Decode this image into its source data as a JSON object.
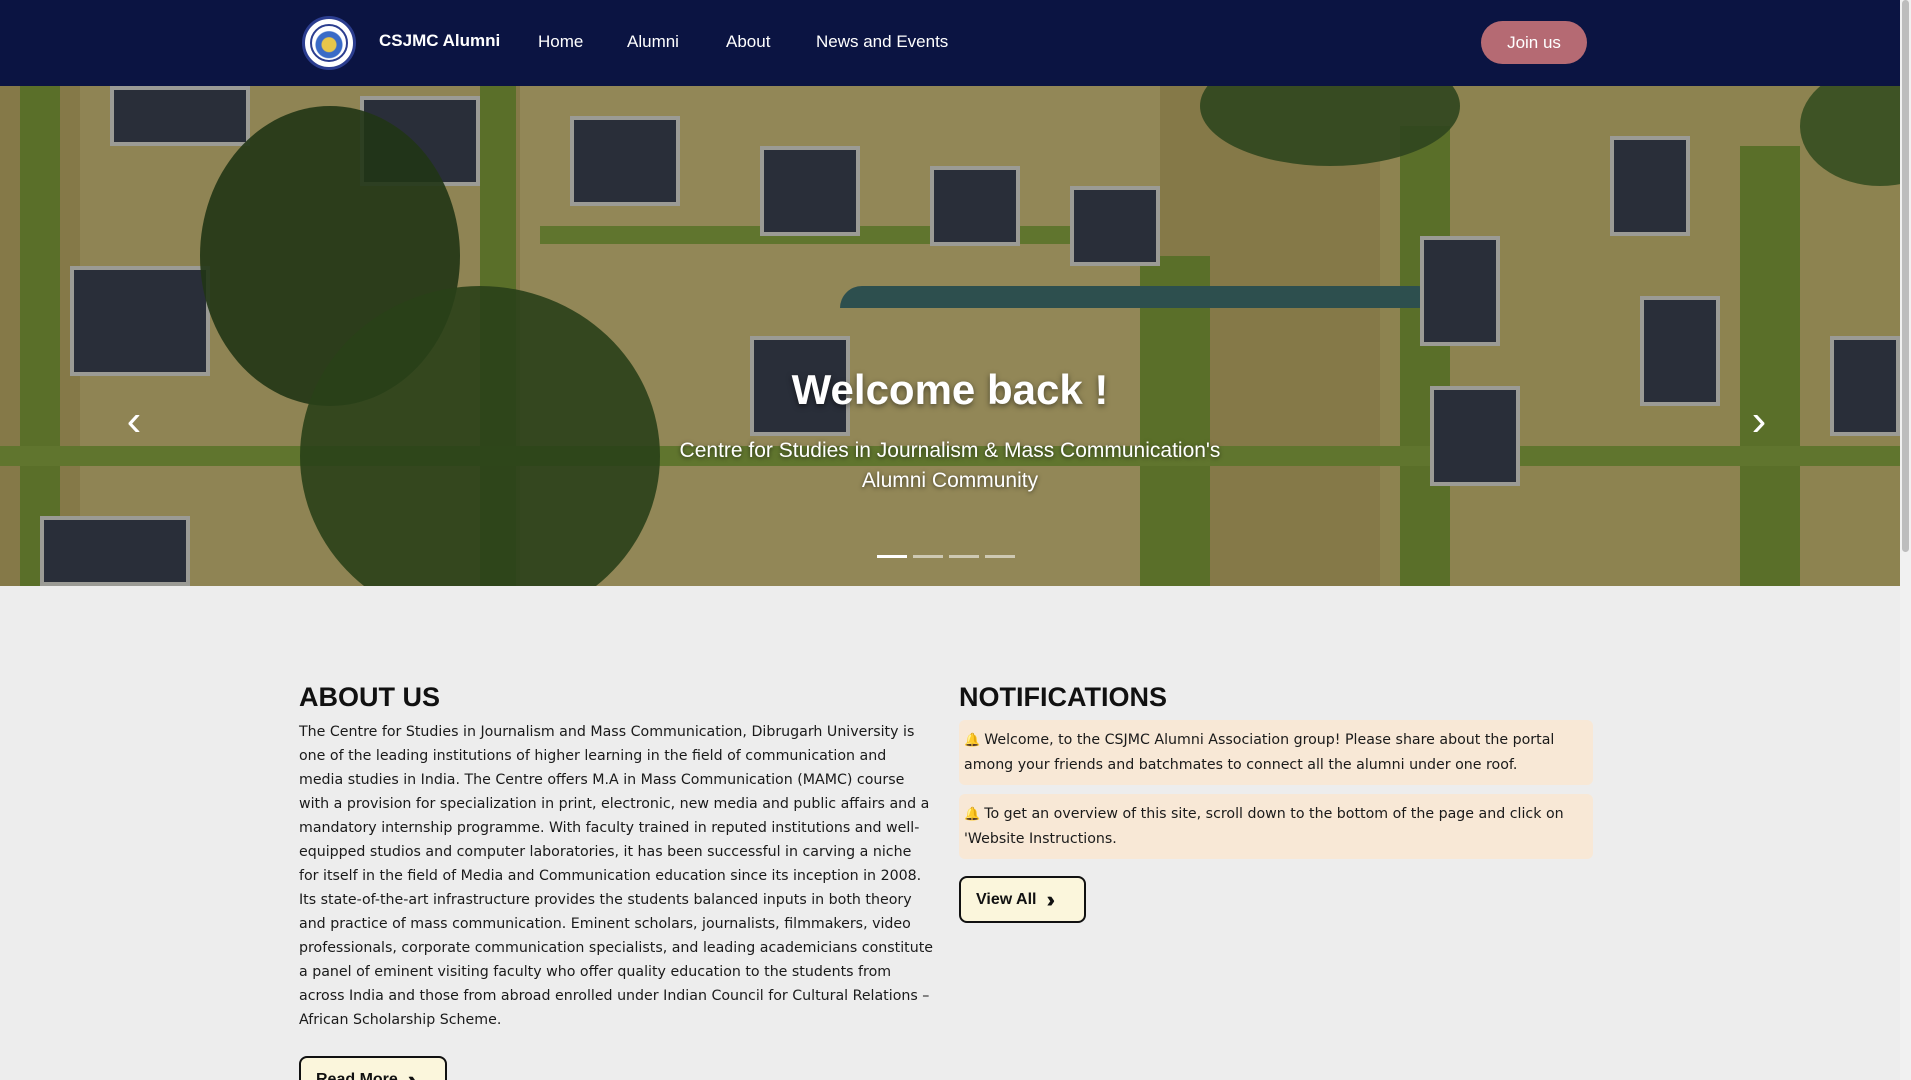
{
  "navbar": {
    "brand": "CSJMC Alumni",
    "links": [
      "Home",
      "Alumni",
      "About",
      "News and Events"
    ],
    "join_label": "Join us"
  },
  "hero": {
    "title": "Welcome back !",
    "subtitle_line1": "Centre for Studies in Journalism & Mass Communication's",
    "subtitle_line2": "Alumni Community",
    "prev_icon": "chevron-left-icon",
    "next_icon": "chevron-right-icon",
    "slide_count": 4,
    "active_slide": 1
  },
  "about": {
    "heading": "ABOUT US",
    "body": "The Centre for Studies in Journalism and Mass Communication, Dibrugarh University is one of the leading institutions of higher learning in the field of communication and media studies in India. The Centre offers M.A in Mass Communication (MAMC) course with a provision for specialization in print, electronic, new media and public affairs and a mandatory internship programme. With faculty trained in reputed institutions and well-equipped studios and computer laboratories, it has been successful in carving a niche for itself in the field of Media and Communication education since its inception in 2008. Its state-of-the-art infrastructure provides the students balanced inputs in both theory and practice of mass communication. Eminent scholars, journalists, filmmakers, video professionals, corporate communication specialists, and leading academicians constitute a panel of eminent visiting faculty who offer quality education to the students from across India and those from abroad enrolled under Indian Council for Cultural Relations – African Scholarship Scheme.",
    "button_label": "Read More"
  },
  "notifications": {
    "heading": "NOTIFICATIONS",
    "items": [
      "Welcome, to the CSJMC Alumni Association group! Please share about the portal among your friends and batchmates to connect all the alumni under one roof.",
      "To get an overview of this site, scroll down to the bottom of the page and click on 'Website Instructions."
    ],
    "button_label": "View All"
  },
  "colors": {
    "navbar_bg": "#0b1442",
    "join_button": "#b56a73",
    "notification_bg": "#f8e8d6",
    "button_bg": "#fbf6dc"
  }
}
